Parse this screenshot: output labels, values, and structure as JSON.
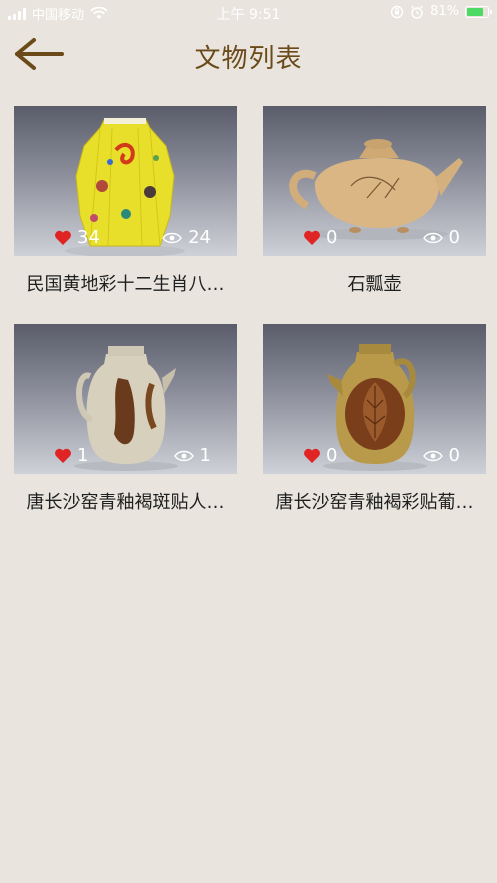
{
  "status": {
    "carrier": "中国移动",
    "time": "上午 9:51",
    "battery": "81%"
  },
  "header": {
    "title": "文物列表",
    "back_icon": "back-arrow-icon"
  },
  "items": [
    {
      "name": "民国黄地彩十二生肖八…",
      "likes": "34",
      "views": "24"
    },
    {
      "name": "石瓢壶",
      "likes": "0",
      "views": "0"
    },
    {
      "name": "唐长沙窑青釉褐斑贴人…",
      "likes": "1",
      "views": "1"
    },
    {
      "name": "唐长沙窑青釉褐彩贴葡…",
      "likes": "0",
      "views": "0"
    }
  ],
  "colors": {
    "accent": "#6b4a1a",
    "background": "#e9e5de",
    "like": "#e02424"
  }
}
